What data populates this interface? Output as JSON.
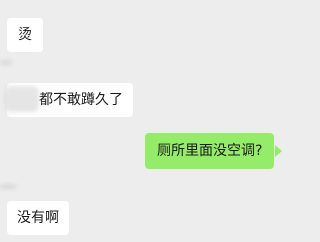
{
  "chat": {
    "messages": [
      {
        "side": "incoming",
        "text": "烫"
      },
      {
        "side": "incoming",
        "text": "都不敢蹲久了"
      },
      {
        "side": "outgoing",
        "text": "厕所里面没空调?"
      },
      {
        "side": "incoming",
        "text": "没有啊"
      }
    ]
  },
  "colors": {
    "background": "#ededed",
    "incoming_bubble": "#ffffff",
    "outgoing_bubble": "#95ec69"
  }
}
